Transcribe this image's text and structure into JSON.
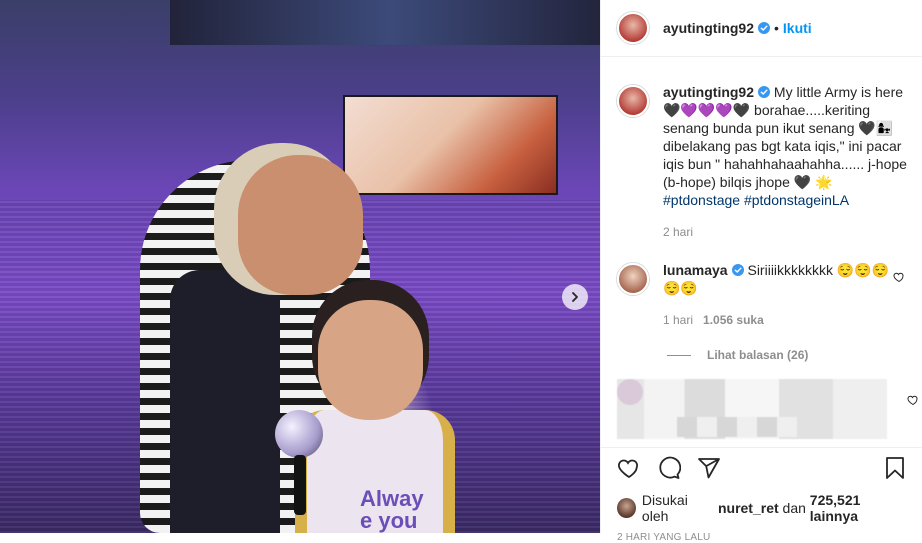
{
  "header": {
    "username": "ayutingting92",
    "separator": "•",
    "follow_label": "Ikuti"
  },
  "caption": {
    "username": "ayutingting92",
    "text": "My little Army is here 🖤💜💜💜🖤 borahae.....keriting senang bunda pun ikut senang 🖤👩‍👧 dibelakang pas bgt kata iqis,\" ini pacar iqis bun \" hahahhahaahahha...... j-hope (b-hope) bilqis jhope 🖤 🌟",
    "hashtags": [
      "#ptdonstage",
      "#ptdonstageinLA"
    ],
    "time": "2 hari"
  },
  "comment": {
    "username": "lunamaya",
    "text": "Siriiiikkkkkkkk 😌😌😌 😌😌",
    "time": "1 hari",
    "likes": "1.056 suka"
  },
  "replies_label": "Lihat balasan (26)",
  "likes": {
    "prefix": "Disukai oleh",
    "user": "nuret_ret",
    "middle": "dan",
    "count": "725,521 lainnya"
  },
  "date": "2 HARI YANG LALU",
  "colors": {
    "accent": "#0095f6",
    "hashtag": "#00376b",
    "muted": "#8e8e8e"
  }
}
